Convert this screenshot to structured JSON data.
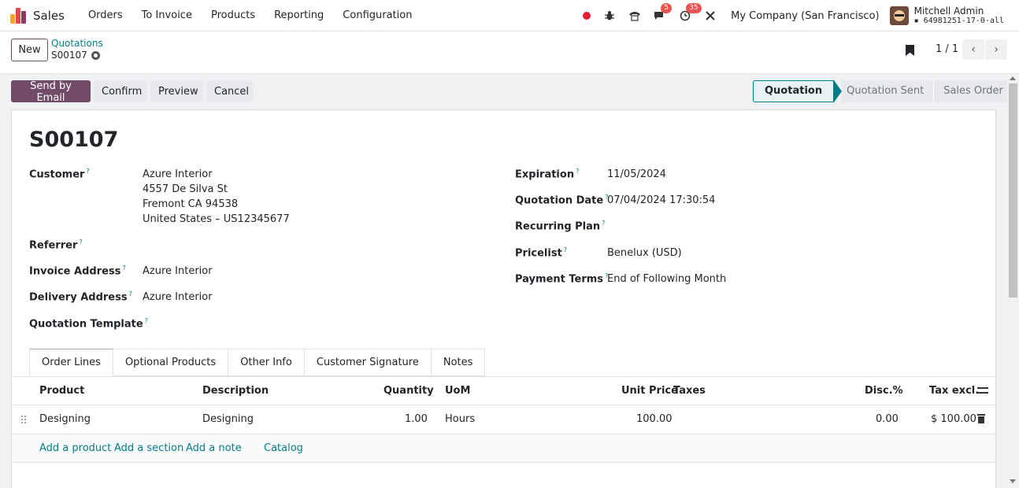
{
  "navbar": {
    "brand": "Sales",
    "menu": [
      "Orders",
      "To Invoice",
      "Products",
      "Reporting",
      "Configuration"
    ],
    "messages_badge": "5",
    "activities_badge": "35",
    "company": "My Company (San Francisco)",
    "user_name": "Mitchell Admin",
    "db_name": "64981251-17-0-all",
    "colors": {
      "brand": "#714b67",
      "accent": "#017e84"
    }
  },
  "control": {
    "new_label": "New",
    "breadcrumb": "Quotations",
    "record": "S00107",
    "pager": "1 / 1"
  },
  "actions": {
    "send_email": "Send by Email",
    "confirm": "Confirm",
    "preview": "Preview",
    "cancel": "Cancel"
  },
  "status": {
    "stages": [
      "Quotation",
      "Quotation Sent",
      "Sales Order"
    ],
    "active": "Quotation"
  },
  "form": {
    "title": "S00107",
    "customer_label": "Customer",
    "customer_lines": [
      "Azure Interior",
      "4557 De Silva St",
      "Fremont CA 94538",
      "United States – US12345677"
    ],
    "referrer_label": "Referrer",
    "invoice_address_label": "Invoice Address",
    "invoice_address": "Azure Interior",
    "delivery_address_label": "Delivery Address",
    "delivery_address": "Azure Interior",
    "template_label": "Quotation Template",
    "expiration_label": "Expiration",
    "expiration": "11/05/2024",
    "quotation_date_label": "Quotation Date",
    "quotation_date": "07/04/2024 17:30:54",
    "recurring_plan_label": "Recurring Plan",
    "pricelist_label": "Pricelist",
    "pricelist": "Benelux (USD)",
    "payment_terms_label": "Payment Terms",
    "payment_terms": "End of Following Month",
    "help_mark": "?"
  },
  "tabs": [
    "Order Lines",
    "Optional Products",
    "Other Info",
    "Customer Signature",
    "Notes"
  ],
  "table": {
    "headers": {
      "product": "Product",
      "description": "Description",
      "quantity": "Quantity",
      "uom": "UoM",
      "unit_price": "Unit Price",
      "taxes": "Taxes",
      "disc": "Disc.%",
      "tax_excl": "Tax excl."
    },
    "rows": [
      {
        "product": "Designing",
        "description": "Designing",
        "quantity": "1.00",
        "uom": "Hours",
        "unit_price": "100.00",
        "taxes": "",
        "disc": "0.00",
        "tax_excl": "$ 100.00"
      }
    ],
    "add_links": {
      "product": "Add a product",
      "section": "Add a section",
      "note": "Add a note",
      "catalog": "Catalog"
    }
  }
}
